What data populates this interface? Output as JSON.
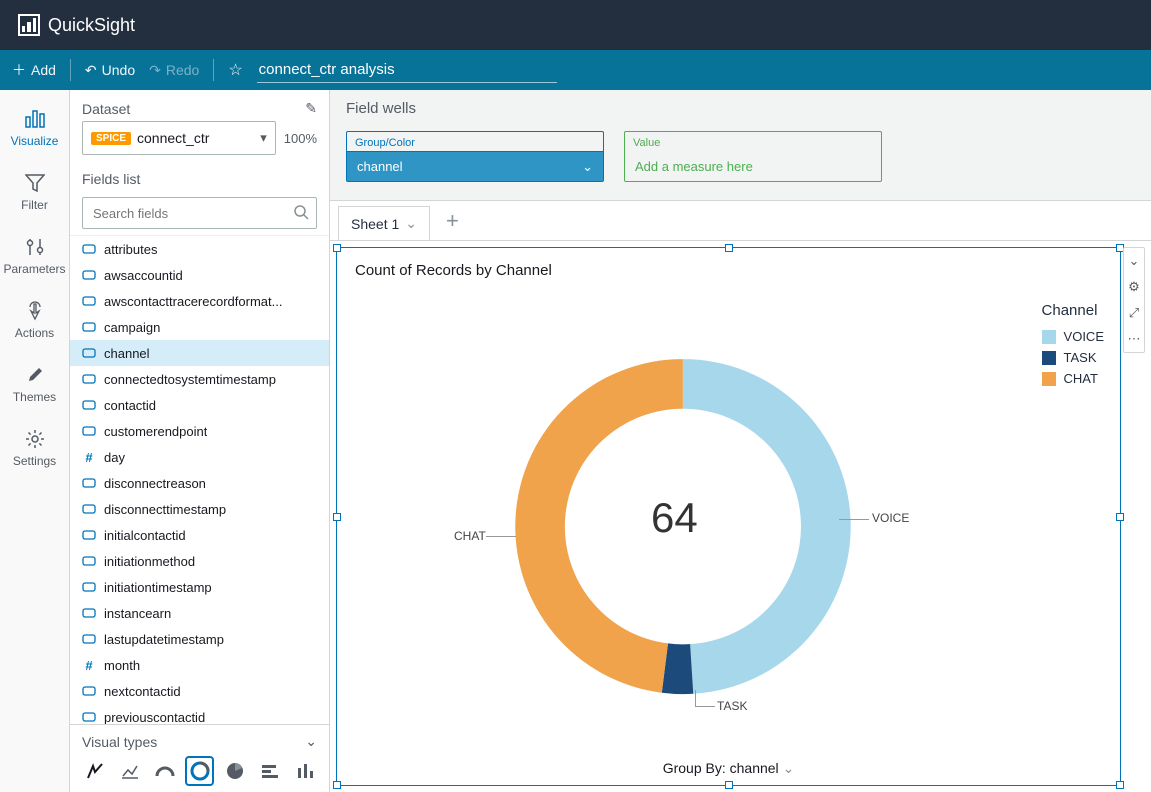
{
  "brand": "QuickSight",
  "actionbar": {
    "add": "Add",
    "undo": "Undo",
    "redo": "Redo",
    "title": "connect_ctr analysis"
  },
  "navrail": [
    {
      "id": "visualize",
      "label": "Visualize"
    },
    {
      "id": "filter",
      "label": "Filter"
    },
    {
      "id": "parameters",
      "label": "Parameters"
    },
    {
      "id": "actions",
      "label": "Actions"
    },
    {
      "id": "themes",
      "label": "Themes"
    },
    {
      "id": "settings",
      "label": "Settings"
    }
  ],
  "dataset": {
    "section_label": "Dataset",
    "badge": "SPICE",
    "name": "connect_ctr",
    "percent": "100%"
  },
  "fields": {
    "section_label": "Fields list",
    "search_placeholder": "Search fields",
    "items": [
      {
        "name": "attributes",
        "type": "dim"
      },
      {
        "name": "awsaccountid",
        "type": "dim"
      },
      {
        "name": "awscontacttracerecordformat...",
        "type": "dim"
      },
      {
        "name": "campaign",
        "type": "dim"
      },
      {
        "name": "channel",
        "type": "dim",
        "selected": true
      },
      {
        "name": "connectedtosystemtimestamp",
        "type": "dim"
      },
      {
        "name": "contactid",
        "type": "dim"
      },
      {
        "name": "customerendpoint",
        "type": "dim"
      },
      {
        "name": "day",
        "type": "measure"
      },
      {
        "name": "disconnectreason",
        "type": "dim"
      },
      {
        "name": "disconnecttimestamp",
        "type": "dim"
      },
      {
        "name": "initialcontactid",
        "type": "dim"
      },
      {
        "name": "initiationmethod",
        "type": "dim"
      },
      {
        "name": "initiationtimestamp",
        "type": "dim"
      },
      {
        "name": "instancearn",
        "type": "dim"
      },
      {
        "name": "lastupdatetimestamp",
        "type": "dim"
      },
      {
        "name": "month",
        "type": "measure"
      },
      {
        "name": "nextcontactid",
        "type": "dim"
      },
      {
        "name": "previouscontactid",
        "type": "dim"
      }
    ]
  },
  "visual_types": {
    "label": "Visual types"
  },
  "field_wells": {
    "title": "Field wells",
    "group_label": "Group/Color",
    "group_value": "channel",
    "value_label": "Value",
    "value_placeholder": "Add a measure here"
  },
  "sheets": {
    "active": "Sheet 1"
  },
  "visual": {
    "title": "Count of Records by Channel",
    "group_by_label": "Group By: channel",
    "center_value": "64",
    "legend_title": "Channel",
    "legend": [
      {
        "name": "VOICE",
        "color": "#a7d7eb"
      },
      {
        "name": "TASK",
        "color": "#1c4a7a"
      },
      {
        "name": "CHAT",
        "color": "#f0a34a"
      }
    ],
    "data_labels": {
      "voice": "VOICE",
      "task": "TASK",
      "chat": "CHAT"
    }
  },
  "chart_data": {
    "type": "pie",
    "title": "Count of Records by Channel",
    "total": 64,
    "categories": [
      "VOICE",
      "CHAT",
      "TASK"
    ],
    "colors": [
      "#a7d7eb",
      "#f0a34a",
      "#1c4a7a"
    ],
    "values_pct": [
      49,
      48,
      3
    ],
    "inner_radius_pct": 70,
    "legend_position": "right"
  }
}
